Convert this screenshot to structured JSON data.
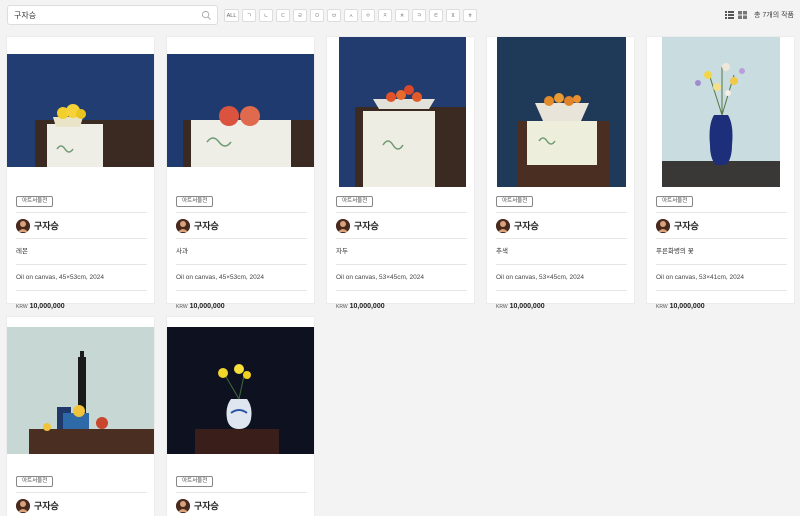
{
  "search": {
    "value": "구자승",
    "placeholder": ""
  },
  "filters": [
    "ALL",
    "ㄱ",
    "ㄴ",
    "ㄷ",
    "ㄹ",
    "ㅁ",
    "ㅂ",
    "ㅅ",
    "ㅇ",
    "ㅈ",
    "ㅊ",
    "ㅋ",
    "ㅌ",
    "ㅍ",
    "ㅎ"
  ],
  "view_icons": [
    "list-view-icon",
    "grid-view-icon"
  ],
  "result_count": "총 7개의 작품",
  "artworks": [
    {
      "badge": "아트서울전",
      "artist": "구자승",
      "title": "레몬",
      "medium": "Oil on canvas, 45×53cm, 2024",
      "currency": "KRW",
      "price": "10,000,000"
    },
    {
      "badge": "아트서울전",
      "artist": "구자승",
      "title": "사과",
      "medium": "Oil on canvas, 45×53cm, 2024",
      "currency": "KRW",
      "price": "10,000,000"
    },
    {
      "badge": "아트서울전",
      "artist": "구자승",
      "title": "자두",
      "medium": "Oil on canvas, 53×45cm, 2024",
      "currency": "KRW",
      "price": "10,000,000"
    },
    {
      "badge": "아트서울전",
      "artist": "구자승",
      "title": "추색",
      "medium": "Oil on canvas, 53×45cm, 2024",
      "currency": "KRW",
      "price": "10,000,000"
    },
    {
      "badge": "아트서울전",
      "artist": "구자승",
      "title": "푸른화병의 꽃",
      "medium": "Oil on canvas, 53×41cm, 2024",
      "currency": "KRW",
      "price": "10,000,000"
    },
    {
      "badge": "아트서울전",
      "artist": "구자승"
    },
    {
      "badge": "아트서울전",
      "artist": "구자승"
    }
  ]
}
